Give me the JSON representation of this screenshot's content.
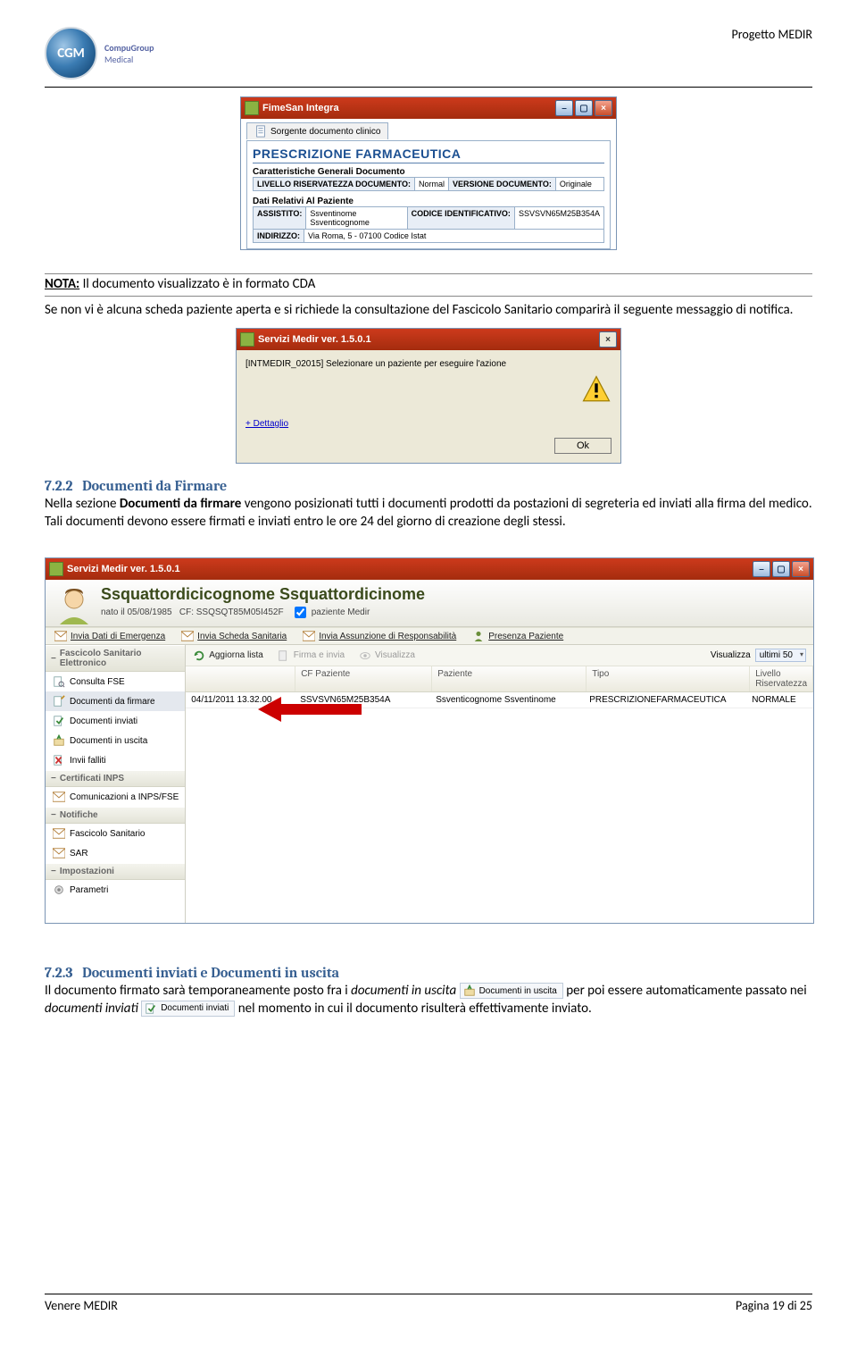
{
  "header": {
    "project": "Progetto MEDIR",
    "logo_abbr": "CGM",
    "logo_text1": "CompuGroup",
    "logo_text2": "Medical"
  },
  "footer": {
    "left": "Venere MEDIR",
    "right": "Pagina 19 di 25"
  },
  "s1": {
    "title": "FimeSan Integra",
    "tab": "Sorgente documento clinico",
    "heading": "PRESCRIZIONE FARMACEUTICA",
    "block1_label": "Caratteristiche Generali Documento",
    "livello_label": "LIVELLO RISERVATEZZA DOCUMENTO:",
    "livello_val": "Normal",
    "versione_label": "VERSIONE DOCUMENTO:",
    "versione_val": "Originale",
    "block2_label": "Dati Relativi Al Paziente",
    "assistito_label": "ASSISTITO:",
    "assistito_val": "Ssventinome Ssventicognome",
    "codice_label": "CODICE IDENTIFICATIVO:",
    "codice_val": "SSVSVN65M25B354A",
    "indirizzo_label": "INDIRIZZO:",
    "indirizzo_val": "Via Roma, 5 - 07100 Codice Istat"
  },
  "nota_label": "NOTA:",
  "nota_text": " Il documento visualizzato è in formato CDA",
  "para1": "Se non vi è alcuna scheda paziente aperta e si richiede la consultazione del Fascicolo Sanitario comparirà il seguente messaggio di notifica.",
  "s2": {
    "title": "Servizi Medir  ver. 1.5.0.1",
    "msg": "[INTMEDIR_02015] Selezionare un paziente per eseguire l'azione",
    "dettaglio": "+ Dettaglio",
    "ok": "Ok"
  },
  "sec722_num": "7.2.2",
  "sec722_title": "Documenti da Firmare",
  "sec722_body_a": "Nella sezione ",
  "sec722_body_b": "Documenti da firmare",
  "sec722_body_c": " vengono posizionati tutti i documenti prodotti da postazioni di segreteria ed inviati alla firma del medico. Tali documenti devono essere firmati e inviati entro le ore 24 del giorno di creazione degli stessi.",
  "s3": {
    "title": "Servizi Medir  ver. 1.5.0.1",
    "patient_name": "Ssquattordicicognome Ssquattordicinome",
    "meta_nato": "nato il 05/08/1985",
    "meta_cf": "CF: SSQSQT85M05I452F",
    "meta_paz": "paziente Medir",
    "links": {
      "l1": "Invia Dati di Emergenza",
      "l2": "Invia Scheda Sanitaria",
      "l3": "Invia Assunzione di Responsabilità",
      "l4": "Presenza Paziente"
    },
    "nav": {
      "g1": "Fascicolo Sanitario Elettronico",
      "g1i1": "Consulta FSE",
      "g1i2": "Documenti da firmare",
      "g1i3": "Documenti inviati",
      "g1i4": "Documenti in uscita",
      "g1i5": "Invii falliti",
      "g2": "Certificati INPS",
      "g2i1": "Comunicazioni a INPS/FSE",
      "g3": "Notifiche",
      "g3i1": "Fascicolo Sanitario",
      "g3i2": "SAR",
      "g4": "Impostazioni",
      "g4i1": "Parametri"
    },
    "toolbar": {
      "t1": "Aggiorna lista",
      "t2": "Firma e invia",
      "t3": "Visualizza",
      "viz_label": "Visualizza",
      "viz_val": "ultimi 50"
    },
    "table": {
      "h1": "",
      "h2": "CF Paziente",
      "h3": "Paziente",
      "h4": "Tipo",
      "h5": "Livello Riservatezza",
      "r1c1": "04/11/2011 13.32.00",
      "r1c2": "SSVSVN65M25B354A",
      "r1c3": "Ssventicognome Ssventinome",
      "r1c4": "PRESCRIZIONEFARMACEUTICA",
      "r1c5": "NORMALE"
    }
  },
  "sec723_num": "7.2.3",
  "sec723_title": "Documenti inviati e Documenti in uscita",
  "sec723_body_a": "Il documento firmato sarà temporaneamente posto fra i ",
  "sec723_body_b": "documenti in uscita",
  "sec723_body_c": " per poi essere automaticamente passato nei ",
  "sec723_body_d": "documenti inviati",
  "sec723_body_e": " nel momento in cui il documento risulterà effettivamente inviato.",
  "snip_uscita": "Documenti in uscita",
  "snip_inviati": "Documenti inviati"
}
